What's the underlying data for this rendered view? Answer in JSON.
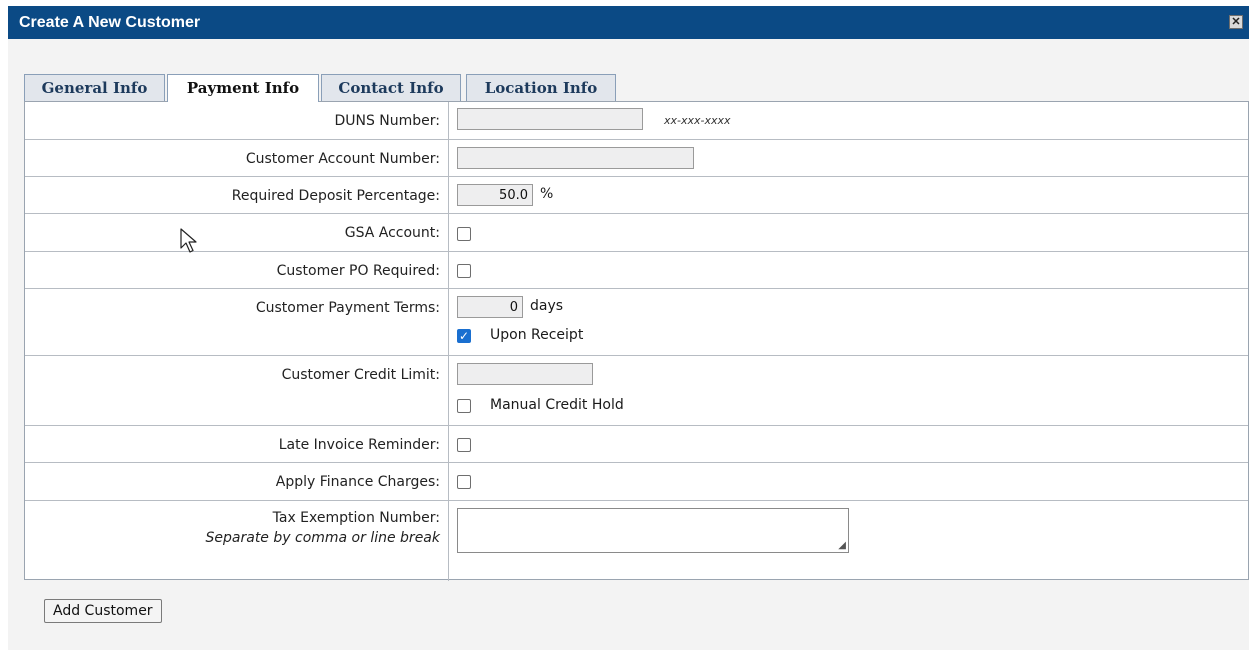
{
  "dialog": {
    "title": "Create A New Customer",
    "close_glyph": "✕"
  },
  "tabs": [
    {
      "label": "General Info",
      "active": false
    },
    {
      "label": "Payment Info",
      "active": true
    },
    {
      "label": "Contact Info",
      "active": false
    },
    {
      "label": "Location Info",
      "active": false
    }
  ],
  "form": {
    "duns": {
      "label": "DUNS Number:",
      "value": "",
      "format_hint": "xx-xxx-xxxx"
    },
    "account_number": {
      "label": "Customer Account Number:",
      "value": ""
    },
    "deposit": {
      "label": "Required Deposit Percentage:",
      "value": "50.0",
      "unit": "%"
    },
    "gsa": {
      "label": "GSA Account:",
      "checked": false
    },
    "po_required": {
      "label": "Customer PO Required:",
      "checked": false
    },
    "payment_terms": {
      "label": "Customer Payment Terms:",
      "value": "0",
      "unit": "days",
      "upon_receipt_label": "Upon Receipt",
      "upon_receipt_checked": true
    },
    "credit_limit": {
      "label": "Customer Credit Limit:",
      "value": "",
      "manual_hold_label": "Manual Credit Hold",
      "manual_hold_checked": false
    },
    "late_reminder": {
      "label": "Late Invoice Reminder:",
      "checked": false
    },
    "finance_charges": {
      "label": "Apply Finance Charges:",
      "checked": false
    },
    "tax_exemption": {
      "label": "Tax Exemption Number:",
      "hint": "Separate by comma or line break",
      "value": ""
    }
  },
  "actions": {
    "add_customer_label": "Add Customer"
  },
  "icons": {
    "close": "close-icon",
    "cursor": "mouse-pointer-icon",
    "checkmark": "checkmark-icon",
    "resize": "resize-grip-icon"
  },
  "colors": {
    "titlebar_bg": "#0b4a85",
    "checkbox_checked": "#1a6fd0",
    "dialog_bg": "#f3f3f3"
  }
}
